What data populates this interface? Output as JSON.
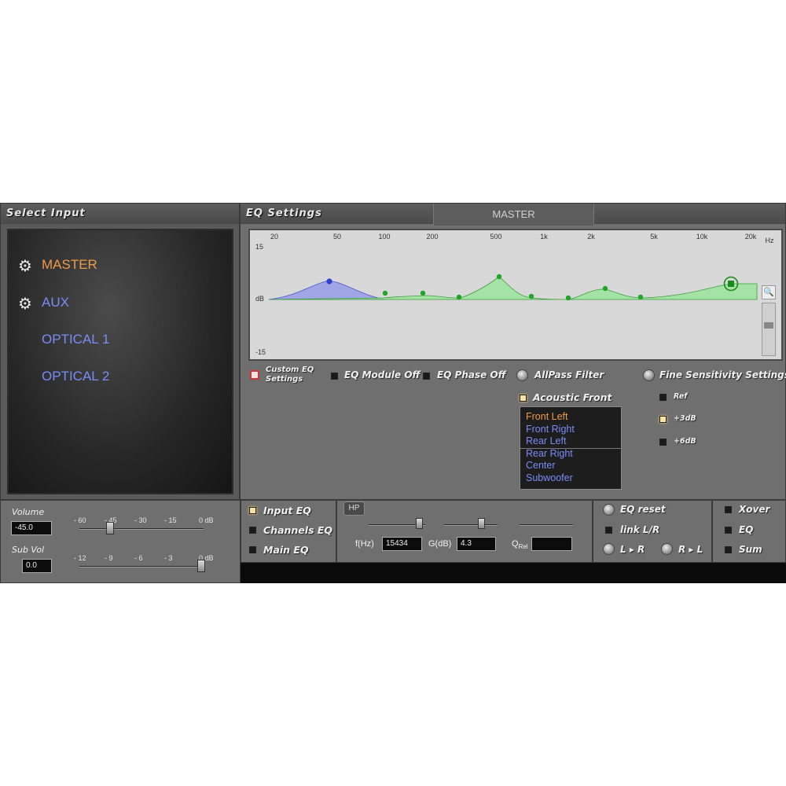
{
  "select_input": {
    "title": "Select Input",
    "items": [
      {
        "label": "MASTER",
        "icon": "gear-icon",
        "active": true
      },
      {
        "label": "AUX",
        "icon": "gear-icon",
        "active": false
      },
      {
        "label": "OPTICAL 1",
        "active": false
      },
      {
        "label": "OPTICAL 2",
        "active": false
      }
    ]
  },
  "eq_settings": {
    "title": "EQ Settings",
    "tab": "MASTER",
    "graph": {
      "freq_labels": [
        "20",
        "50",
        "100",
        "200",
        "500",
        "1k",
        "2k",
        "5k",
        "10k",
        "20k"
      ],
      "unit": "Hz",
      "db_top": "15",
      "db_mid": "dB",
      "db_bottom": "-15"
    },
    "options": {
      "custom_eq": "Custom EQ Settings",
      "eq_module_off": "EQ Module Off",
      "eq_phase_off": "EQ Phase Off",
      "allpass": "AllPass Filter",
      "fine_sensitivity": "Fine Sensitivity Settings",
      "acoustic_front": "Acoustic Front",
      "ref": "Ref",
      "plus3": "+3dB",
      "plus6": "+6dB"
    },
    "channels": [
      "Front Left",
      "Front Right",
      "Rear Left",
      "Rear Right",
      "Center",
      "Subwoofer"
    ]
  },
  "volume": {
    "label": "Volume",
    "value": "-45.0",
    "scale": [
      "- 60",
      "- 45",
      "- 30",
      "- 15",
      "0 dB"
    ]
  },
  "sub_vol": {
    "label": "Sub Vol",
    "value": "0.0",
    "scale": [
      "- 12",
      "- 9",
      "- 6",
      "- 3",
      "0 dB"
    ]
  },
  "eq_select": {
    "input_eq": "Input EQ",
    "channels_eq": "Channels EQ",
    "main_eq": "Main EQ"
  },
  "filter": {
    "hp": "HP",
    "f_label": "f(Hz)",
    "f_value": "15434",
    "g_label": "G(dB)",
    "g_value": "4.3",
    "q_label": "Q",
    "q_sub": "Rel",
    "q_value": ""
  },
  "actions": {
    "eq_reset": "EQ reset",
    "link_lr": "link L/R",
    "l_to_r": "L ▸ R",
    "r_to_l": "R ▸ L"
  },
  "right_opts": {
    "xover": "Xover",
    "eq": "EQ",
    "sum": "Sum"
  },
  "colors": {
    "active_label": "#ee9b4a",
    "inactive_label": "#7a8cf5",
    "curve_fill": "#9be39b",
    "low_shelf_fill": "#8c93e8",
    "point_green": "#22a32a",
    "point_blue": "#2f3fd0"
  }
}
